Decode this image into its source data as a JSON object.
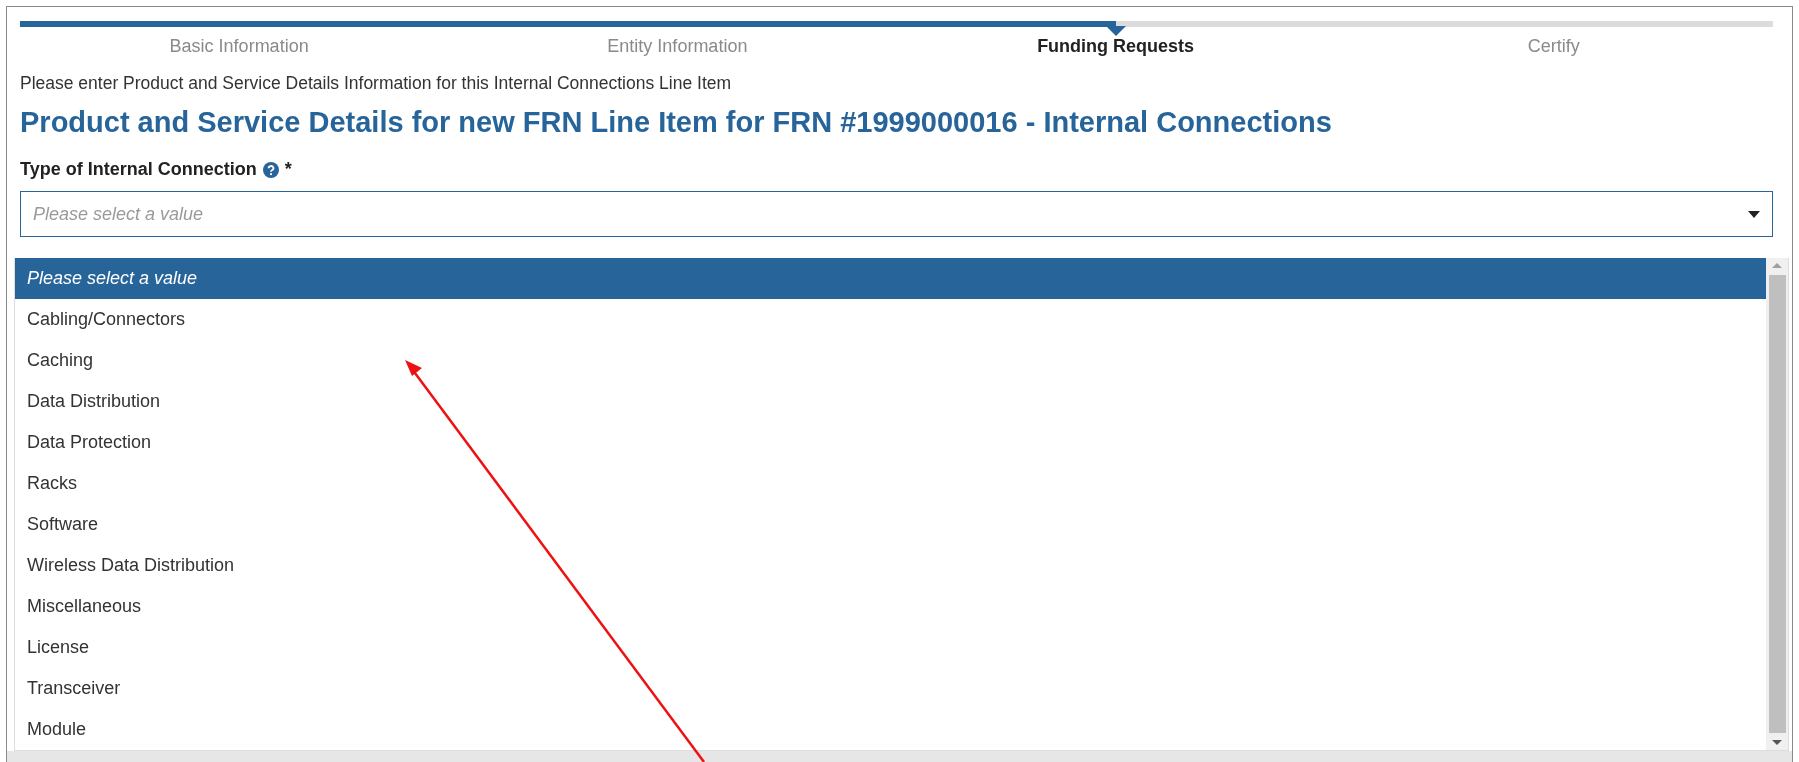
{
  "steps": [
    {
      "label": "Basic Information",
      "selected": false
    },
    {
      "label": "Entity Information",
      "selected": false
    },
    {
      "label": "Funding Requests",
      "selected": true
    },
    {
      "label": "Certify",
      "selected": false
    }
  ],
  "instruction": "Please enter Product and Service Details Information for this Internal Connections Line Item",
  "heading": "Product and Service Details for new FRN Line Item for FRN #1999000016 - Internal Connections",
  "field": {
    "label": "Type of Internal Connection",
    "required_mark": "*",
    "placeholder": "Please select a value",
    "expanded": true
  },
  "options": [
    {
      "label": "Please select a value",
      "kind": "placeholder",
      "selected": true
    },
    {
      "label": "Cabling/Connectors",
      "kind": "option",
      "selected": false
    },
    {
      "label": "Caching",
      "kind": "option",
      "selected": false
    },
    {
      "label": "Data Distribution",
      "kind": "option",
      "selected": false
    },
    {
      "label": "Data Protection",
      "kind": "option",
      "selected": false
    },
    {
      "label": "Racks",
      "kind": "option",
      "selected": false
    },
    {
      "label": "Software",
      "kind": "option",
      "selected": false
    },
    {
      "label": "Wireless Data Distribution",
      "kind": "option",
      "selected": false
    },
    {
      "label": "Miscellaneous",
      "kind": "option",
      "selected": false
    },
    {
      "label": "License",
      "kind": "option",
      "selected": false
    },
    {
      "label": "Transceiver",
      "kind": "option",
      "selected": false
    },
    {
      "label": "Module",
      "kind": "option",
      "selected": false
    }
  ]
}
